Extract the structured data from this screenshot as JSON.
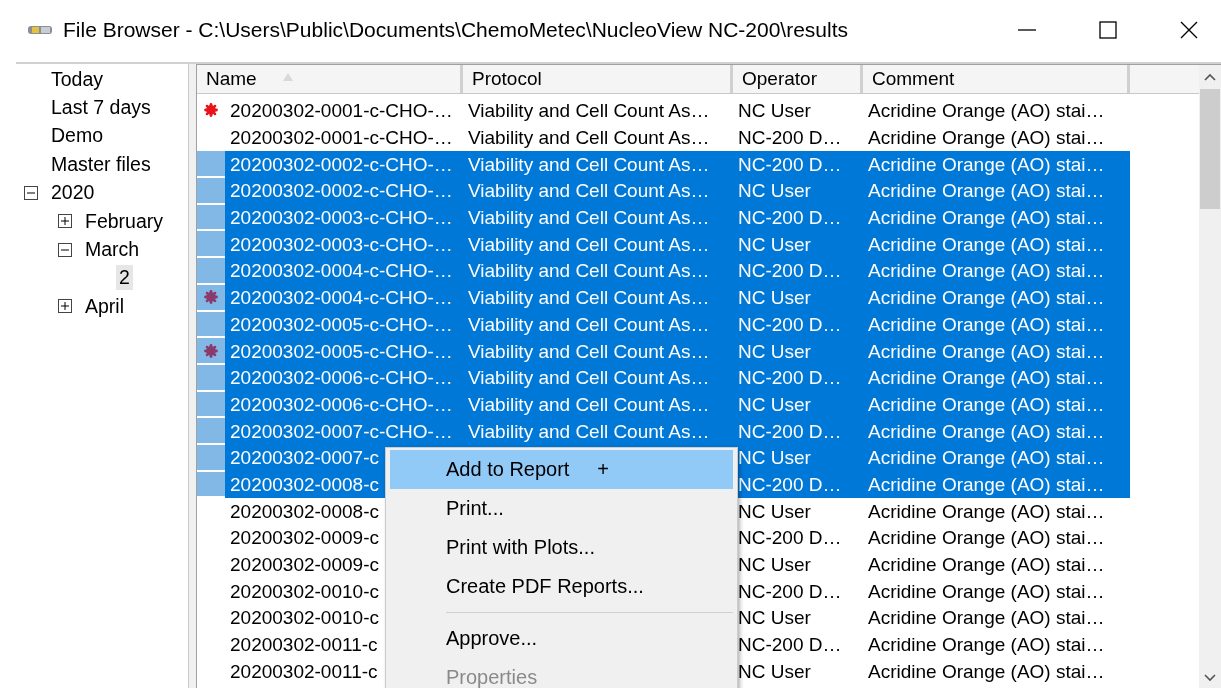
{
  "window": {
    "title": "File Browser - C:\\Users\\Public\\Documents\\ChemoMetec\\NucleoView NC-200\\results"
  },
  "tree": [
    {
      "label": "Today",
      "selected": false
    },
    {
      "label": "Last 7 days",
      "selected": false
    },
    {
      "label": "Demo",
      "selected": false
    },
    {
      "label": "Master files",
      "selected": false
    },
    {
      "label": "2020",
      "selected": false,
      "expanded": true,
      "children": [
        {
          "label": "February",
          "selected": false,
          "expanded": false
        },
        {
          "label": "March",
          "selected": false,
          "expanded": true,
          "children": [
            {
              "label": "2",
              "selected": true
            }
          ]
        },
        {
          "label": "April",
          "selected": false,
          "expanded": false
        }
      ]
    }
  ],
  "table": {
    "columns": [
      {
        "label": "Name",
        "sorted": true
      },
      {
        "label": "Protocol"
      },
      {
        "label": "Operator"
      },
      {
        "label": "Comment"
      }
    ],
    "rows": [
      {
        "name": "20200302-0001-c-CHO-…",
        "protocol": "Viability and Cell Count As…",
        "operator": "NC User",
        "comment": "Acridine Orange (AO) stai…",
        "selected": false,
        "color": "#e8141c"
      },
      {
        "name": "20200302-0001-c-CHO-…",
        "protocol": "Viability and Cell Count As…",
        "operator": "NC-200 D…",
        "comment": "Acridine Orange (AO) stai…",
        "selected": false
      },
      {
        "name": "20200302-0002-c-CHO-…",
        "protocol": "Viability and Cell Count As…",
        "operator": "NC-200 D…",
        "comment": "Acridine Orange (AO) stai…",
        "selected": true
      },
      {
        "name": "20200302-0002-c-CHO-…",
        "protocol": "Viability and Cell Count As…",
        "operator": "NC User",
        "comment": "Acridine Orange (AO) stai…",
        "selected": true
      },
      {
        "name": "20200302-0003-c-CHO-…",
        "protocol": "Viability and Cell Count As…",
        "operator": "NC-200 D…",
        "comment": "Acridine Orange (AO) stai…",
        "selected": true
      },
      {
        "name": "20200302-0003-c-CHO-…",
        "protocol": "Viability and Cell Count As…",
        "operator": "NC User",
        "comment": "Acridine Orange (AO) stai…",
        "selected": true
      },
      {
        "name": "20200302-0004-c-CHO-…",
        "protocol": "Viability and Cell Count As…",
        "operator": "NC-200 D…",
        "comment": "Acridine Orange (AO) stai…",
        "selected": true
      },
      {
        "name": "20200302-0004-c-CHO-…",
        "protocol": "Viability and Cell Count As…",
        "operator": "NC User",
        "comment": "Acridine Orange (AO) stai…",
        "selected": true,
        "color": "#8b3a6b"
      },
      {
        "name": "20200302-0005-c-CHO-…",
        "protocol": "Viability and Cell Count As…",
        "operator": "NC-200 D…",
        "comment": "Acridine Orange (AO) stai…",
        "selected": true
      },
      {
        "name": "20200302-0005-c-CHO-…",
        "protocol": "Viability and Cell Count As…",
        "operator": "NC User",
        "comment": "Acridine Orange (AO) stai…",
        "selected": true,
        "color": "#8b3a6b"
      },
      {
        "name": "20200302-0006-c-CHO-…",
        "protocol": "Viability and Cell Count As…",
        "operator": "NC-200 D…",
        "comment": "Acridine Orange (AO) stai…",
        "selected": true
      },
      {
        "name": "20200302-0006-c-CHO-…",
        "protocol": "Viability and Cell Count As…",
        "operator": "NC User",
        "comment": "Acridine Orange (AO) stai…",
        "selected": true
      },
      {
        "name": "20200302-0007-c-CHO-…",
        "protocol": "Viability and Cell Count As…",
        "operator": "NC-200 D…",
        "comment": "Acridine Orange (AO) stai…",
        "selected": true
      },
      {
        "name": "20200302-0007-c",
        "operator": "NC User",
        "comment": "Acridine Orange (AO) stai…",
        "selected": true
      },
      {
        "name": "20200302-0008-c",
        "operator": "NC-200 D…",
        "comment": "Acridine Orange (AO) stai…",
        "selected": true
      },
      {
        "name": "20200302-0008-c",
        "operator": "NC User",
        "comment": "Acridine Orange (AO) stai…",
        "selected": false
      },
      {
        "name": "20200302-0009-c",
        "operator": "NC-200 D…",
        "comment": "Acridine Orange (AO) stai…",
        "selected": false
      },
      {
        "name": "20200302-0009-c",
        "operator": "NC User",
        "comment": "Acridine Orange (AO) stai…",
        "selected": false
      },
      {
        "name": "20200302-0010-c",
        "operator": "NC-200 D…",
        "comment": "Acridine Orange (AO) stai…",
        "selected": false
      },
      {
        "name": "20200302-0010-c",
        "operator": "NC User",
        "comment": "Acridine Orange (AO) stai…",
        "selected": false
      },
      {
        "name": "20200302-0011-c",
        "operator": "NC-200 D…",
        "comment": "Acridine Orange (AO) stai…",
        "selected": false
      },
      {
        "name": "20200302-0011-c",
        "operator": "NC User",
        "comment": "Acridine Orange (AO) stai…",
        "selected": false
      }
    ]
  },
  "context_menu": {
    "items": [
      {
        "kind": "item",
        "label": "Add to Report",
        "shortcut": "+",
        "selected": true,
        "disabled": false
      },
      {
        "kind": "item",
        "label": "Print...",
        "selected": false,
        "disabled": false
      },
      {
        "kind": "item",
        "label": "Print with Plots...",
        "selected": false,
        "disabled": false
      },
      {
        "kind": "item",
        "label": "Create PDF Reports...",
        "selected": false,
        "disabled": false
      },
      {
        "kind": "separator"
      },
      {
        "kind": "item",
        "label": "Approve...",
        "selected": false,
        "disabled": false
      },
      {
        "kind": "item",
        "label": "Properties",
        "selected": false,
        "disabled": true
      }
    ]
  }
}
